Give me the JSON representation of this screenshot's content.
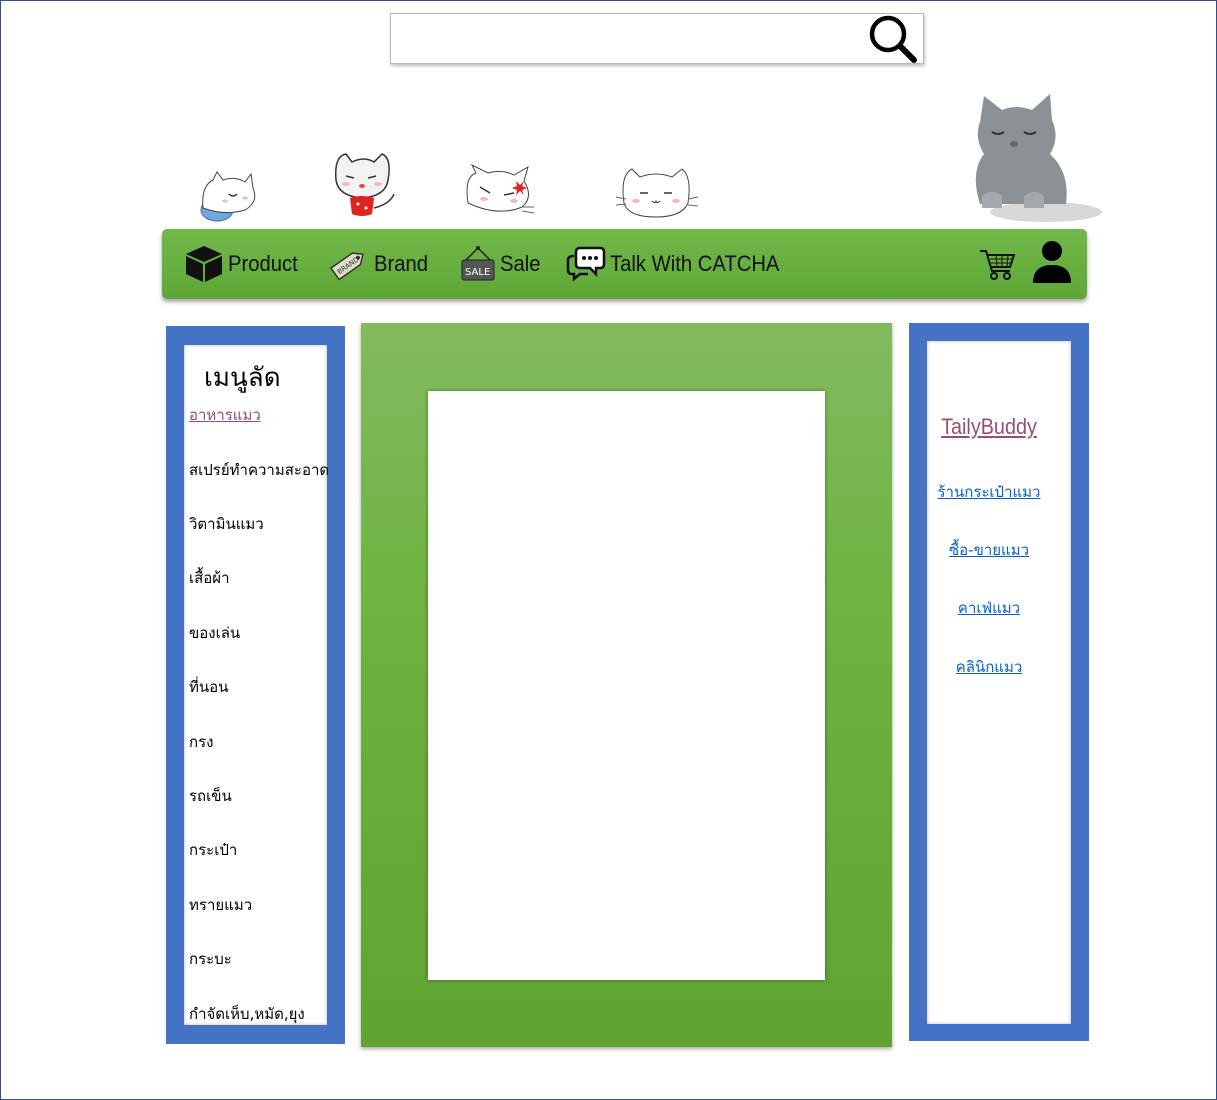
{
  "search": {
    "value": "",
    "placeholder": ""
  },
  "nav": {
    "items": [
      {
        "label": "Product",
        "icon": "box-icon"
      },
      {
        "label": "Brand",
        "icon": "brand-tag-icon"
      },
      {
        "label": "Sale",
        "icon": "sale-sign-icon"
      },
      {
        "label": "Talk With CATCHA",
        "icon": "chat-bubble-icon"
      }
    ],
    "cart_icon": "cart-icon",
    "user_icon": "user-icon"
  },
  "left_menu": {
    "title": "เมนูลัด",
    "items": [
      "อาหารแมว",
      "สเปรย์ทำความสะอาด",
      "วิตามินแมว",
      "เสื้อผ้า",
      "ของเล่น",
      "ที่นอน",
      "กรง",
      "รถเข็น",
      "กระเป๋า",
      "ทรายแมว",
      "กระบะ",
      "กำจัดเห็บ,หมัด,ยุง"
    ]
  },
  "right_menu": {
    "title": "TailyBuddy",
    "links": [
      "ร้านกระเป๋าแมว",
      "ซื้อ-ขายแมว",
      "คาเฟ่แมว",
      "คลินิกแมว"
    ]
  },
  "colors": {
    "nav_green": "#66ad3e",
    "panel_blue": "#4472c4",
    "visited_link": "#954f72",
    "link_blue": "#0563c1"
  }
}
